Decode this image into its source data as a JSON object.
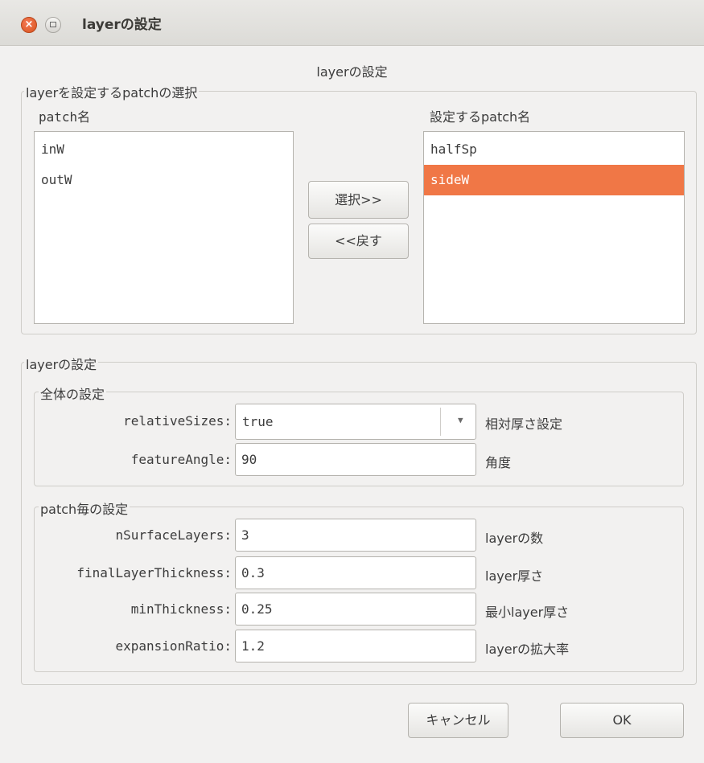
{
  "window": {
    "title": "layerの設定"
  },
  "dialog_heading": "layerの設定",
  "patch_selection": {
    "group_title": "layerを設定するpatchの選択",
    "available_label": "patch名",
    "available_items": [
      "inW",
      "outW"
    ],
    "selected_label": "設定するpatch名",
    "selected_items": [
      "halfSp",
      "sideW"
    ],
    "highlighted_item": "sideW",
    "select_button": "選択>>",
    "back_button": "<<戻す"
  },
  "layer_settings": {
    "group_title": "layerの設定",
    "global": {
      "group_title": "全体の設定",
      "relativeSizes": {
        "label": "relativeSizes:",
        "value": "true",
        "hint": "相対厚さ設定"
      },
      "featureAngle": {
        "label": "featureAngle:",
        "value": "90",
        "hint": "角度"
      }
    },
    "per_patch": {
      "group_title": "patch毎の設定",
      "nSurfaceLayers": {
        "label": "nSurfaceLayers:",
        "value": "3",
        "hint": "layerの数"
      },
      "finalLayerThickness": {
        "label": "finalLayerThickness:",
        "value": "0.3",
        "hint": "layer厚さ"
      },
      "minThickness": {
        "label": "minThickness:",
        "value": "0.25",
        "hint": "最小layer厚さ"
      },
      "expansionRatio": {
        "label": "expansionRatio:",
        "value": "1.2",
        "hint": "layerの拡大率"
      }
    }
  },
  "buttons": {
    "cancel": "キャンセル",
    "ok": "OK"
  },
  "colors": {
    "selection": "#f07746",
    "close_button": "#e0612d",
    "window_bg": "#f2f1f0"
  }
}
